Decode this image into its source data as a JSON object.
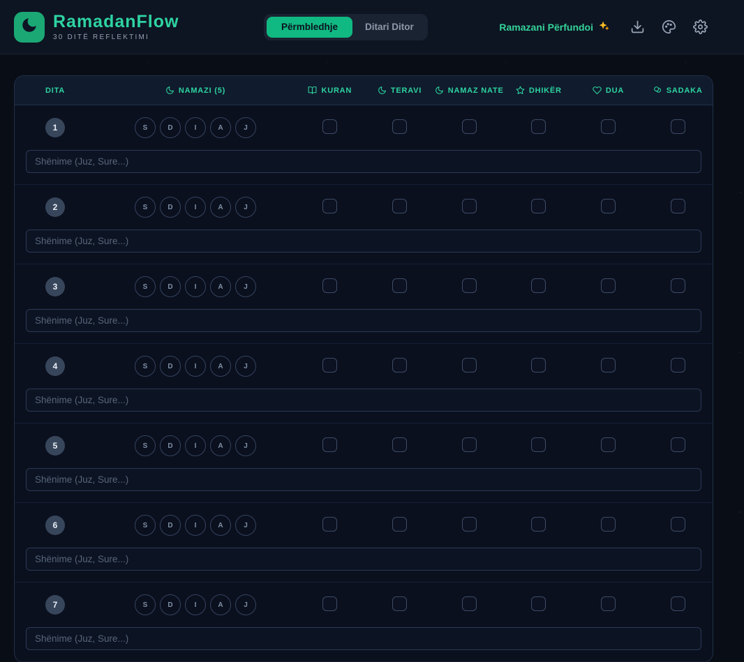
{
  "app": {
    "title": "RamadanFlow",
    "subtitle": "30 DITË REFLEKTIMI",
    "status": "Ramazani Përfundoi",
    "status_icon": "sparkles-icon"
  },
  "tabs": [
    {
      "key": "permbledhje",
      "label": "Përmbledhje",
      "active": true
    },
    {
      "key": "ditari-ditor",
      "label": "Ditari Ditor",
      "active": false
    }
  ],
  "toolbar": [
    {
      "key": "download",
      "icon": "download-icon"
    },
    {
      "key": "theme",
      "icon": "palette-icon"
    },
    {
      "key": "settings",
      "icon": "gear-icon"
    }
  ],
  "colors": {
    "accent_green": "#10b981",
    "label_green": "#2dd4a0",
    "logo_green": "#1ba875",
    "page_bg": "#090d16",
    "table_bg": "#0a101e",
    "table_header_bg": "#101b2d"
  },
  "table": {
    "columns": [
      {
        "key": "dita",
        "label": "DITA",
        "icon": null
      },
      {
        "key": "namazi",
        "label": "NAMAZI (5)",
        "icon": "moon-icon"
      },
      {
        "key": "kuran",
        "label": "KURAN",
        "icon": "book-icon"
      },
      {
        "key": "teravi",
        "label": "TERAVI",
        "icon": "moon-icon"
      },
      {
        "key": "namaz-nate",
        "label": "NAMAZ NATE",
        "icon": "moon-icon"
      },
      {
        "key": "dhiker",
        "label": "DHIKËR",
        "icon": "star-icon"
      },
      {
        "key": "dua",
        "label": "DUA",
        "icon": "heart-icon"
      },
      {
        "key": "sadaka",
        "label": "SADAKA",
        "icon": "coins-icon"
      }
    ],
    "prayer_buttons": [
      "S",
      "D",
      "I",
      "A",
      "J"
    ],
    "note_placeholder": "Shënime (Juz, Sure...)",
    "visible_days": [
      1,
      2,
      3,
      4,
      5,
      6,
      7
    ]
  }
}
